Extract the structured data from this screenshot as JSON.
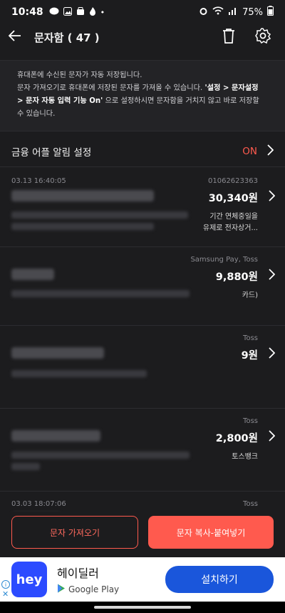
{
  "status_bar": {
    "time": "10:48",
    "battery": "75%"
  },
  "header": {
    "title": "문자함 ( 47 )"
  },
  "info": {
    "line1": "휴대폰에 수신된 문자가 자동 저장됩니다.",
    "line2_pre": "문자 가져오기로 휴대폰에 저장된 문자를 가져올 수 있습니다. ",
    "line2_bold": "'설정 > 문자설정",
    "line3_bold": "> 문자 자동 입력 기능 On'",
    "line3_post": " 으로 설정하시면 문자함을 거치지 않고 바로 저장할",
    "line4": "수 있습니다."
  },
  "setting": {
    "label": "금융 어플 알림 설정",
    "status": "ON"
  },
  "messages": [
    {
      "date": "03.13 16:40:05",
      "source": "01062623363",
      "amount": "30,340원",
      "tail1": "기간 연체중일을",
      "tail2": "유제로 전자상거..."
    },
    {
      "date": "",
      "source": "Samsung Pay, Toss",
      "amount": "9,880원",
      "tail1": "카드)",
      "tail2": ""
    },
    {
      "date": "",
      "source": "Toss",
      "amount": "9원",
      "tail1": "",
      "tail2": ""
    },
    {
      "date": "",
      "source": "Toss",
      "amount": "2,800원",
      "tail1": "토스뱅크",
      "tail2": ""
    },
    {
      "date": "03.03 18:07:06",
      "source": "Toss",
      "amount": "",
      "tail1": "",
      "tail2": ""
    }
  ],
  "buttons": {
    "import": "문자 가져오기",
    "paste": "문자 복사-붙여넣기"
  },
  "ad": {
    "logo_text": "hey",
    "app_name": "헤이딜러",
    "store": "Google Play",
    "install": "설치하기"
  },
  "colors": {
    "accent": "#ff5a4e",
    "background": "#1c1c1e",
    "install_blue": "#1a56db"
  }
}
